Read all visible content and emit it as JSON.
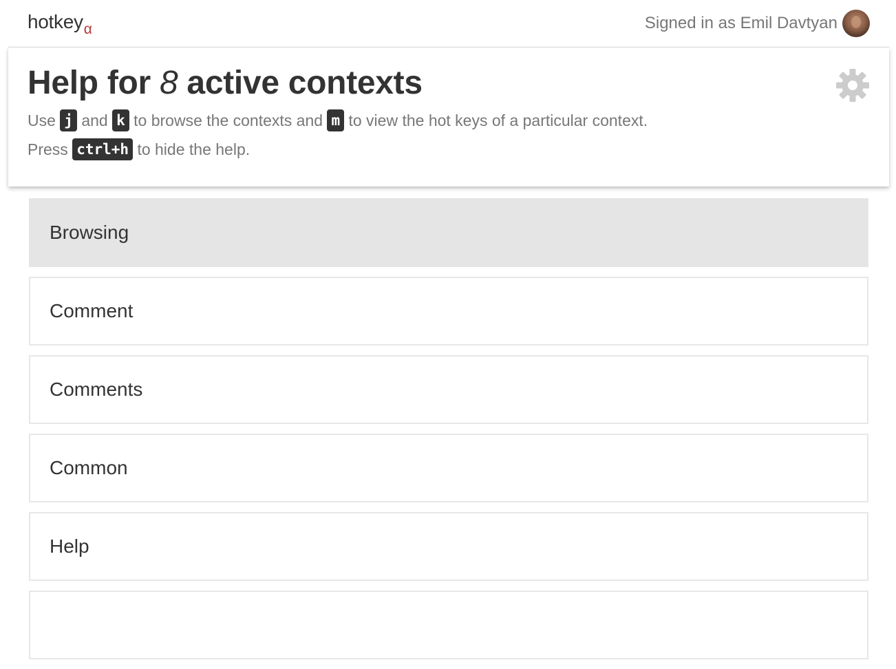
{
  "header": {
    "brand_name": "hotkey",
    "brand_suffix": "α",
    "signed_in_text": "Signed in as Emil Davtyan"
  },
  "help": {
    "title_prefix": "Help for ",
    "context_count": "8",
    "title_suffix": " active contexts",
    "line1_use": "Use",
    "key_next": "j",
    "line1_and": "and",
    "key_prev": "k",
    "line1_browse": "to browse the contexts and",
    "key_view": "m",
    "line1_view": "to view the hot keys of a particular context.",
    "line2_press": "Press",
    "key_hide": "ctrl+h",
    "line2_hide": "to hide the help."
  },
  "icons": {
    "settings": "gear-icon",
    "avatar": "user-avatar"
  },
  "colors": {
    "brand_accent": "#b33a3a",
    "key_background": "#333333",
    "active_item": "#e5e5e5",
    "muted_text": "#777777"
  },
  "contexts": [
    {
      "label": "Browsing",
      "active": true
    },
    {
      "label": "Comment",
      "active": false
    },
    {
      "label": "Comments",
      "active": false
    },
    {
      "label": "Common",
      "active": false
    },
    {
      "label": "Help",
      "active": false
    },
    {
      "label": "",
      "active": false
    }
  ]
}
